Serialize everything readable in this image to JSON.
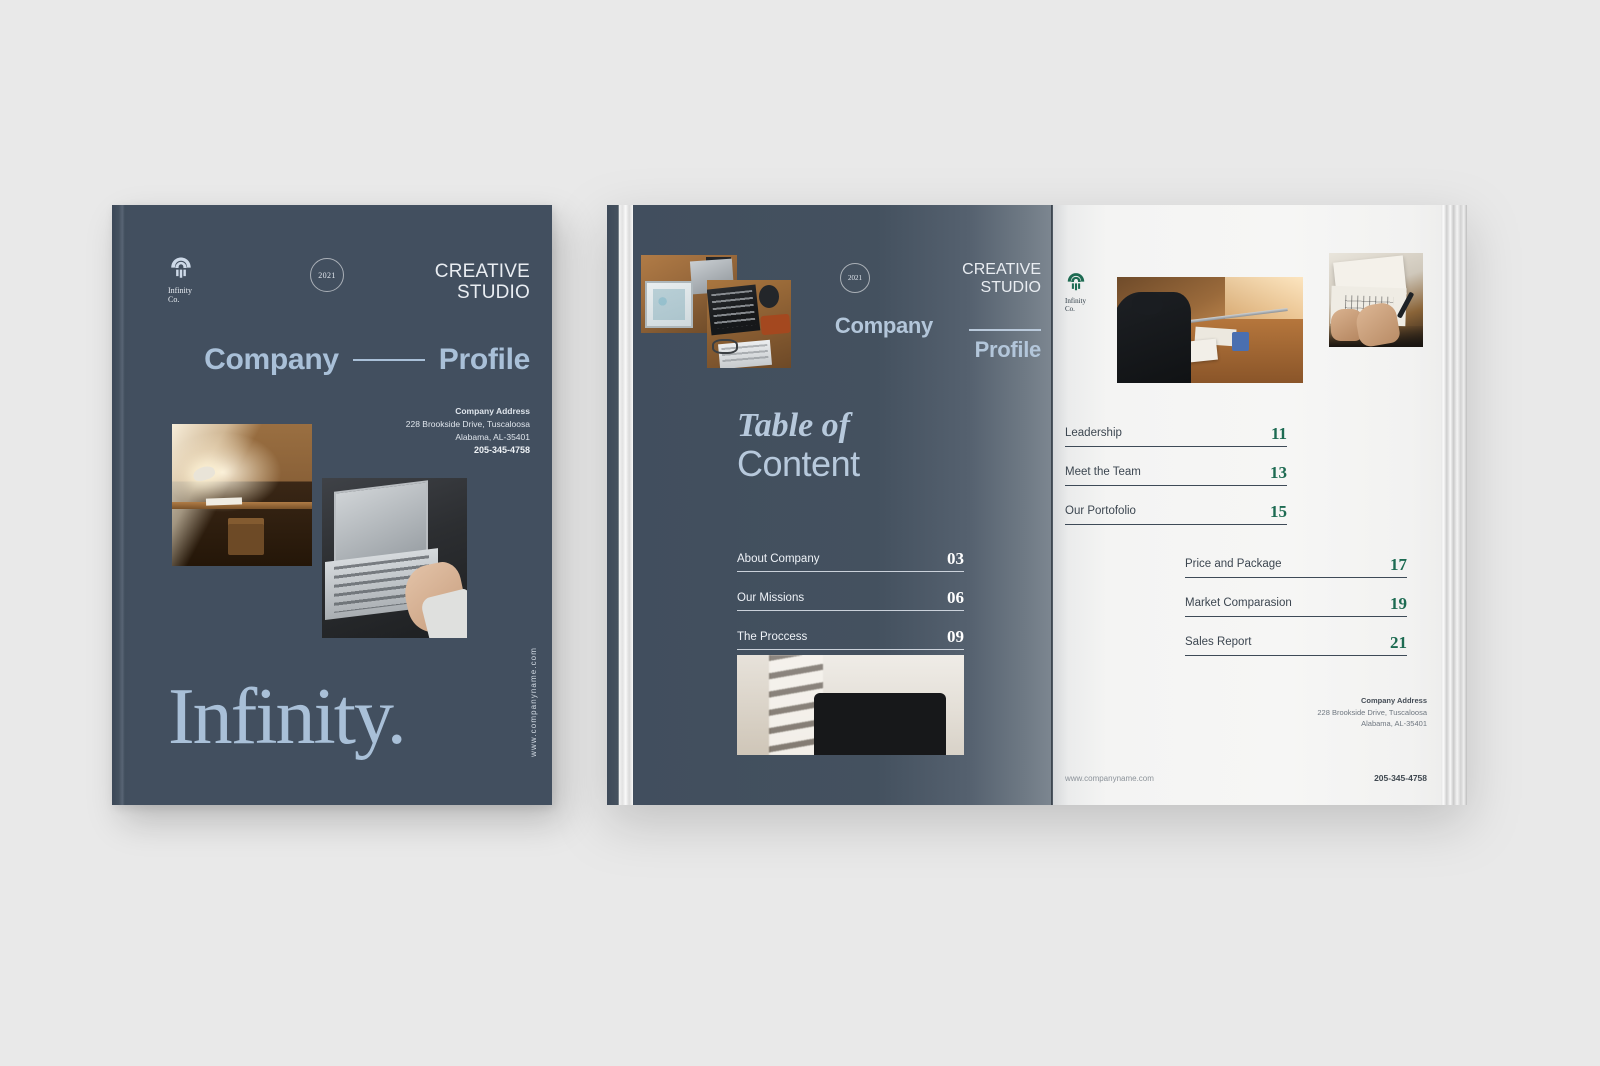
{
  "brand": {
    "name": "Infinity",
    "name_line1": "Infinity",
    "name_line2": "Co.",
    "wordmark": "Infinity.",
    "year_badge": "2021",
    "tagline_line1": "CREATIVE",
    "tagline_line2": "STUDIO",
    "accent_slate": "#424f5f",
    "accent_light_blue": "#a9c0d8",
    "accent_green": "#1d6b52"
  },
  "cover": {
    "title_word1": "Company",
    "title_word2": "Profile",
    "address_title": "Company Address",
    "address_line1": "228 Brookside Drive, Tuscaloosa",
    "address_line2": "Alabama, AL-35401",
    "phone": "205-345-4758",
    "website_vertical": "www.companyname.com",
    "photos": [
      {
        "name": "wooden-desk-with-lamp"
      },
      {
        "name": "laptop-and-hands"
      }
    ]
  },
  "spread": {
    "left_page": {
      "title_word1": "Company",
      "title_word2": "Profile",
      "toc_heading_italic": "Table of",
      "toc_heading_plain": "Content",
      "toc": [
        {
          "label": "About Company",
          "page": "03"
        },
        {
          "label": "Our Missions",
          "page": "06"
        },
        {
          "label": "The Proccess",
          "page": "09"
        }
      ],
      "photos": [
        {
          "name": "desk-flatlay-tablet"
        },
        {
          "name": "laptop-and-mug-flatlay"
        },
        {
          "name": "interior-with-curtain"
        }
      ]
    },
    "right_page": {
      "toc_column_1": [
        {
          "label": "Leadership",
          "page": "11"
        },
        {
          "label": "Meet the Team",
          "page": "13"
        },
        {
          "label": "Our Portofolio",
          "page": "15"
        }
      ],
      "toc_column_2": [
        {
          "label": "Price and Package",
          "page": "17"
        },
        {
          "label": "Market Comparasion",
          "page": "19"
        },
        {
          "label": "Sales Report",
          "page": "21"
        }
      ],
      "address_title": "Company Address",
      "address_line1": "228 Brookside Drive, Tuscaloosa",
      "address_line2": "Alabama, AL-35401",
      "website": "www.companyname.com",
      "phone": "205-345-4758",
      "photos": [
        {
          "name": "man-at-drafting-desk"
        },
        {
          "name": "hand-sketching-on-paper"
        }
      ]
    }
  }
}
